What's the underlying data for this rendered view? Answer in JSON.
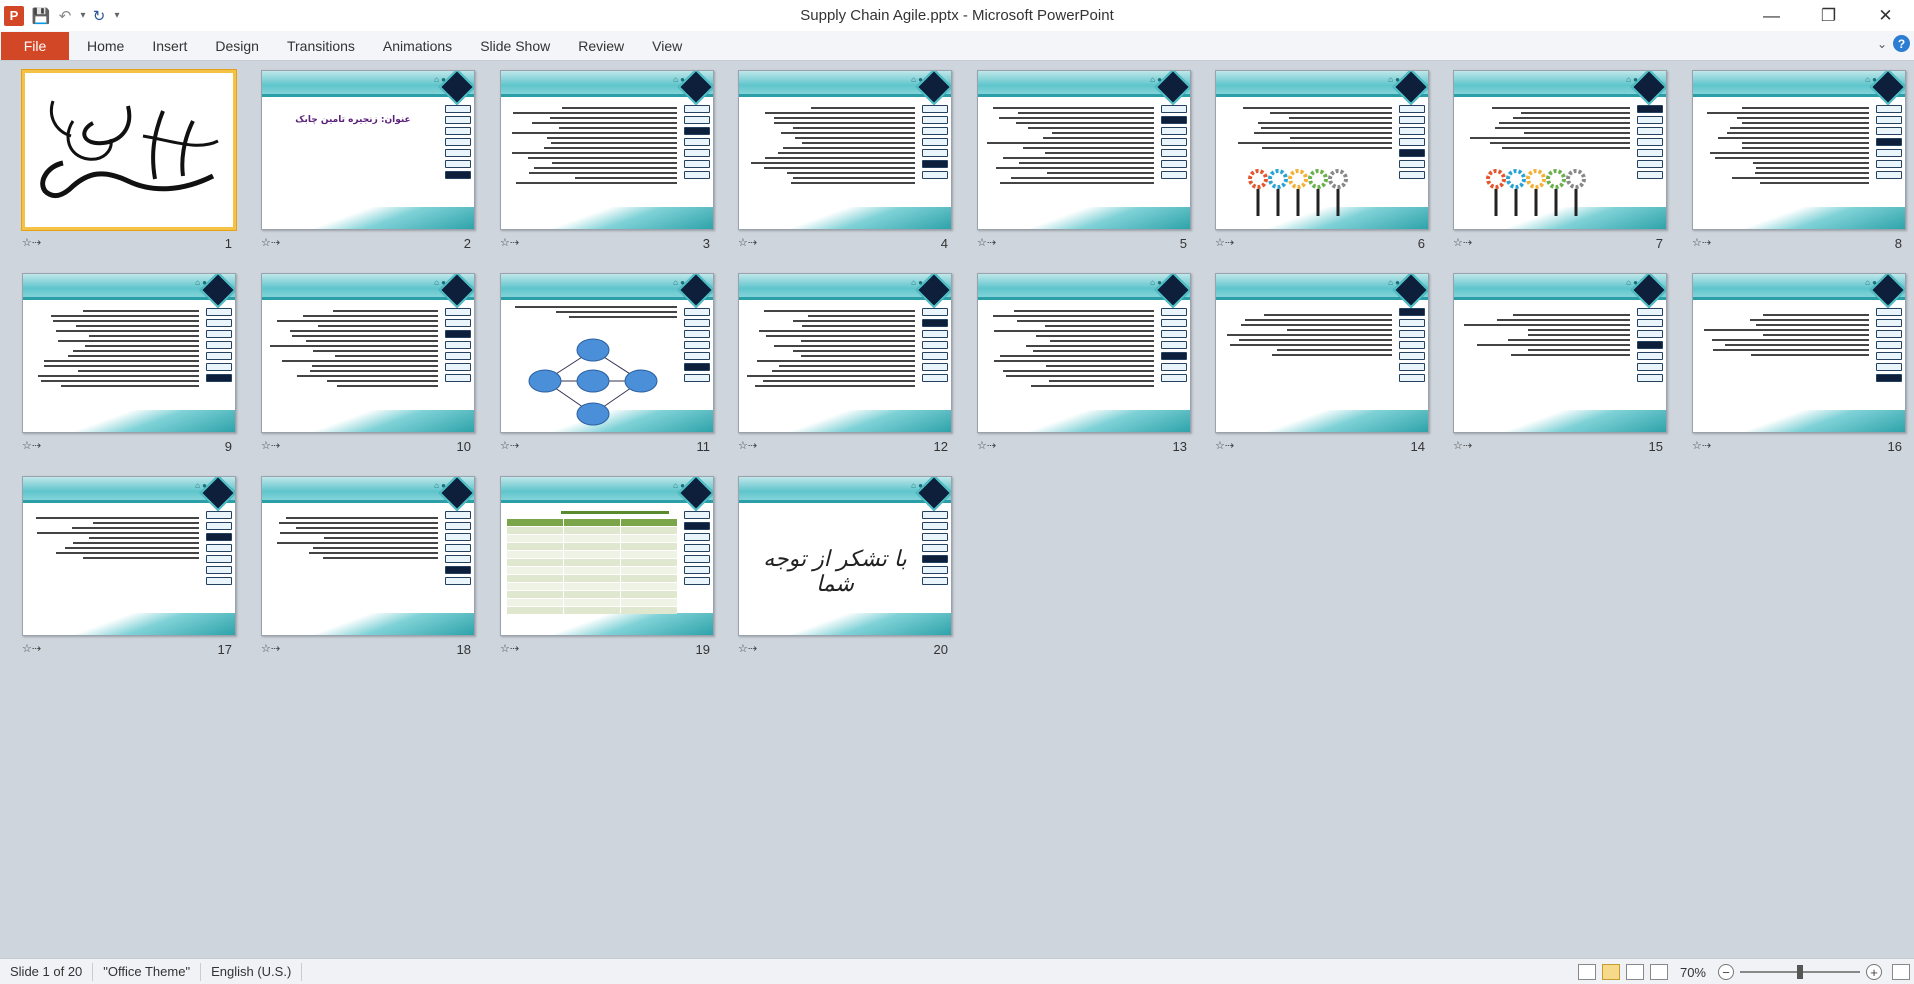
{
  "app": {
    "window_title": "Supply Chain Agile.pptx - Microsoft PowerPoint",
    "logo_letter": "P"
  },
  "quick_access": [
    {
      "name": "save-icon",
      "glyph": "💾"
    },
    {
      "name": "undo-icon",
      "glyph": "↶"
    },
    {
      "name": "undo-dropdown-icon",
      "glyph": "▾"
    },
    {
      "name": "redo-icon",
      "glyph": "↻"
    },
    {
      "name": "customize-qat-icon",
      "glyph": "▾"
    }
  ],
  "window_controls": [
    {
      "name": "minimize-button",
      "glyph": "—"
    },
    {
      "name": "restore-button",
      "glyph": "❐"
    },
    {
      "name": "close-button",
      "glyph": "✕"
    }
  ],
  "ribbon": {
    "file_label": "File",
    "tabs": [
      "Home",
      "Insert",
      "Design",
      "Transitions",
      "Animations",
      "Slide Show",
      "Review",
      "View"
    ]
  },
  "slides": [
    {
      "number": "1",
      "kind": "calligraphy",
      "selected": true
    },
    {
      "number": "2",
      "kind": "title",
      "text": "عنوان: زنجیره تامین چابک"
    },
    {
      "number": "3",
      "kind": "text"
    },
    {
      "number": "4",
      "kind": "text"
    },
    {
      "number": "5",
      "kind": "text"
    },
    {
      "number": "6",
      "kind": "image"
    },
    {
      "number": "7",
      "kind": "image"
    },
    {
      "number": "8",
      "kind": "text"
    },
    {
      "number": "9",
      "kind": "text"
    },
    {
      "number": "10",
      "kind": "text"
    },
    {
      "number": "11",
      "kind": "diagram"
    },
    {
      "number": "12",
      "kind": "text"
    },
    {
      "number": "13",
      "kind": "text"
    },
    {
      "number": "14",
      "kind": "list"
    },
    {
      "number": "15",
      "kind": "list"
    },
    {
      "number": "16",
      "kind": "list"
    },
    {
      "number": "17",
      "kind": "list"
    },
    {
      "number": "18",
      "kind": "list"
    },
    {
      "number": "19",
      "kind": "table"
    },
    {
      "number": "20",
      "kind": "thanks",
      "text": "با تشکر از توجه شما"
    }
  ],
  "status": {
    "slide_info": "Slide 1 of 20",
    "theme": "\"Office Theme\"",
    "language": "English (U.S.)",
    "zoom": "70%",
    "zoom_fraction": 0.5
  }
}
